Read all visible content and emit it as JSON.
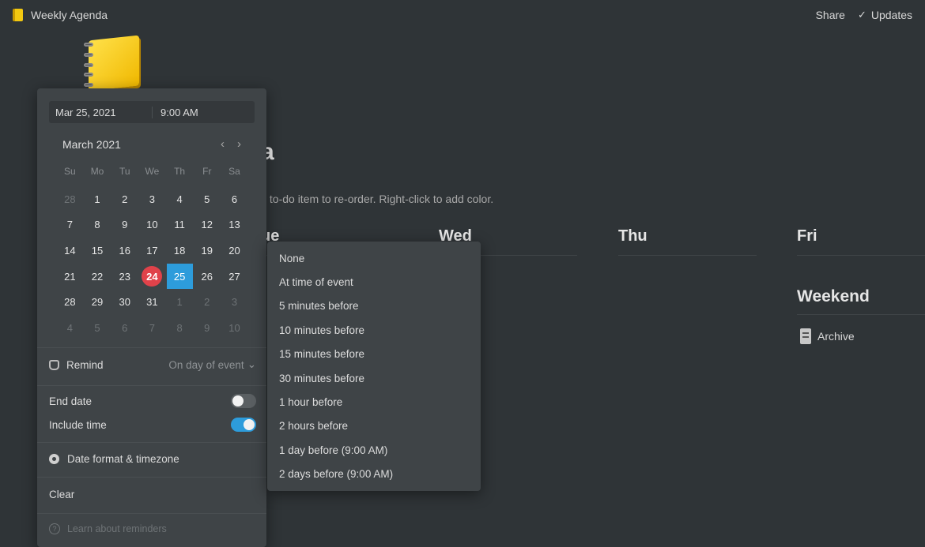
{
  "topbar": {
    "title": "Weekly Agenda",
    "share": "Share",
    "updates": "Updates"
  },
  "page": {
    "title": "a",
    "hint": "y to-do item to re-order. Right-click to add color.",
    "columns": [
      "ue",
      "Wed",
      "Thu",
      "Fri"
    ],
    "weekend": "Weekend",
    "archive": "Archive"
  },
  "picker": {
    "date": "Mar 25, 2021",
    "time": "9:00 AM",
    "month": "March 2021",
    "weekdays": [
      "Su",
      "Mo",
      "Tu",
      "We",
      "Th",
      "Fr",
      "Sa"
    ],
    "days": [
      "28",
      "1",
      "2",
      "3",
      "4",
      "5",
      "6",
      "7",
      "8",
      "9",
      "10",
      "11",
      "12",
      "13",
      "14",
      "15",
      "16",
      "17",
      "18",
      "19",
      "20",
      "21",
      "22",
      "23",
      "24",
      "25",
      "26",
      "27",
      "28",
      "29",
      "30",
      "31",
      "1",
      "2",
      "3",
      "4",
      "5",
      "6",
      "7",
      "8",
      "9",
      "10"
    ],
    "today": "24",
    "selected": "25",
    "remind_label": "Remind",
    "remind_value": "On day of event",
    "end_date_label": "End date",
    "end_date_on": false,
    "include_time_label": "Include time",
    "include_time_on": true,
    "format_label": "Date format & timezone",
    "clear_label": "Clear",
    "learn_label": "Learn about reminders"
  },
  "remind_options": [
    "None",
    "At time of event",
    "5 minutes before",
    "10 minutes before",
    "15 minutes before",
    "30 minutes before",
    "1 hour before",
    "2 hours before",
    "1 day before (9:00 AM)",
    "2 days before (9:00 AM)"
  ],
  "colors": {
    "background": "#2f3437",
    "panel": "#3f4447",
    "accent": "#2d9cdb",
    "today": "#e0424a",
    "page_icon": "#f2c811"
  }
}
